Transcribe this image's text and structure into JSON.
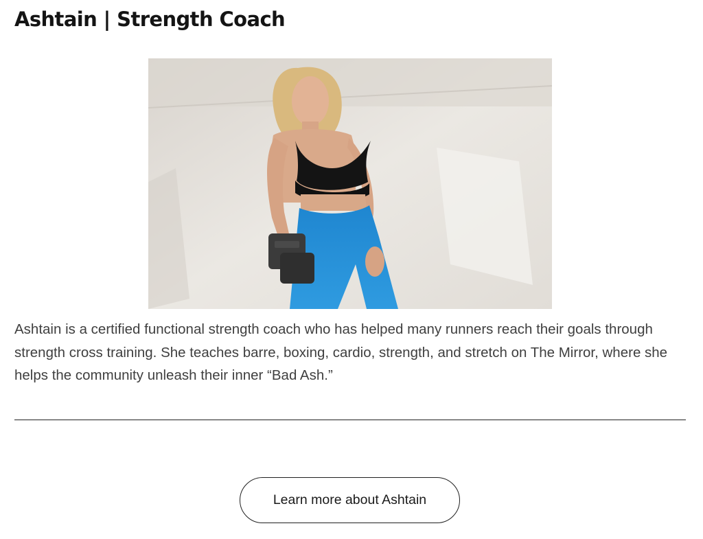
{
  "article": {
    "title": "Ashtain | Strength Coach",
    "bio": "Ashtain is a certified functional strength coach who has helped many runners reach their goals through strength cross training. She teaches barre, boxing, cardio, strength, and stretch on The Mirror, where she helps the community unleash their inner “Bad Ash.”",
    "cta_label": "Learn more about Ashtain"
  },
  "photo": {
    "subject": "coach-portrait-with-dumbbells",
    "colors": {
      "background": "#e7e3dd",
      "top": "#141414",
      "leggings": "#2a8fd6",
      "dumbbell": "#3a3a3a",
      "skin": "#d8a888",
      "hair": "#e2c48a"
    }
  }
}
